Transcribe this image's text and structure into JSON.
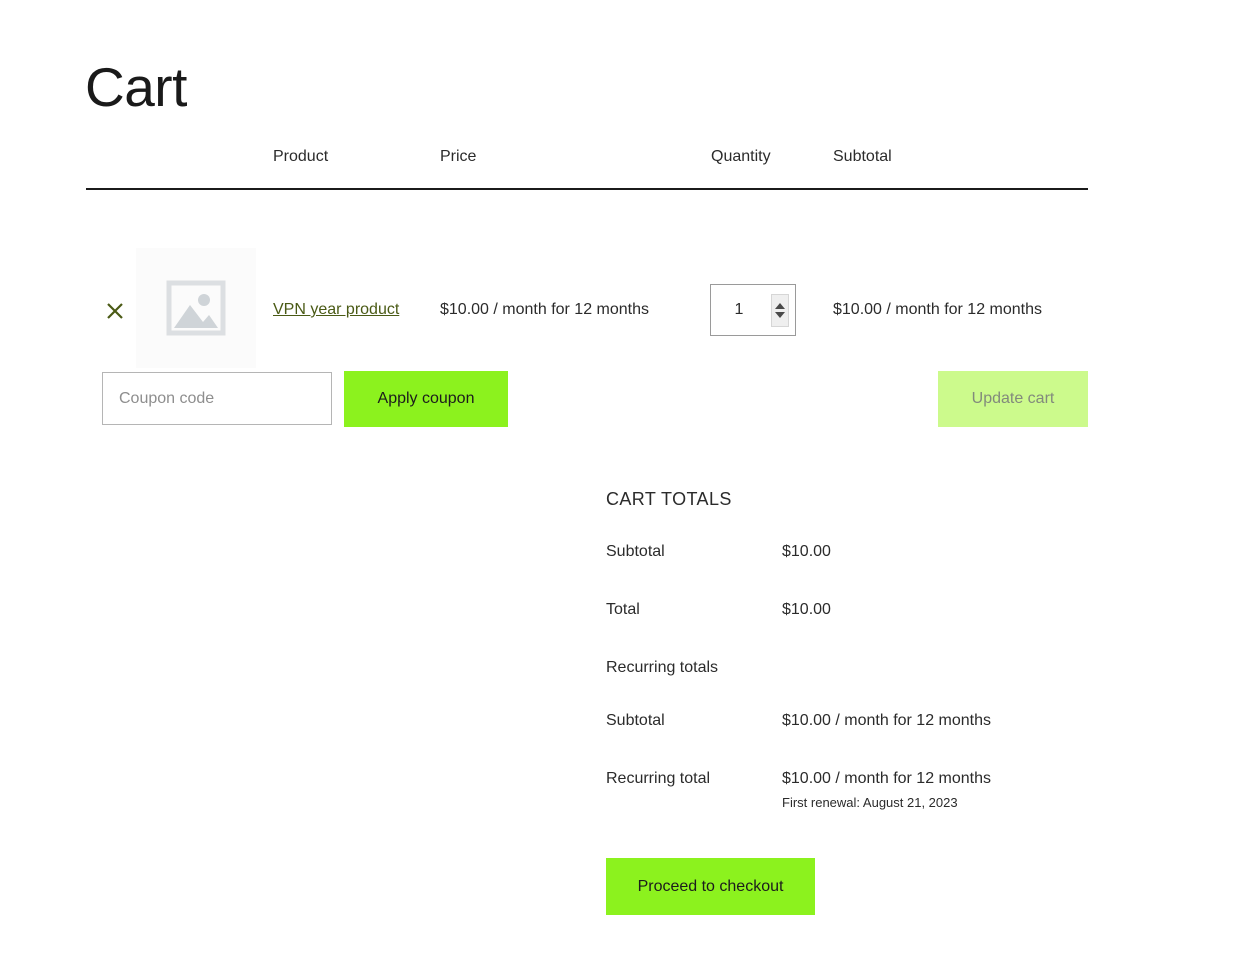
{
  "page": {
    "title": "Cart"
  },
  "cart_table": {
    "columns": [
      "Product",
      "Price",
      "Quantity",
      "Subtotal"
    ],
    "rows": [
      {
        "remove_icon": "close-x-icon",
        "thumbnail_icon": "image-placeholder-icon",
        "product_name": "VPN year product",
        "price": "$10.00 / month for 12 months",
        "quantity": "1",
        "subtotal": "$10.00 / month for 12 months"
      }
    ]
  },
  "coupon": {
    "placeholder": "Coupon code",
    "value": "",
    "apply_label": "Apply coupon"
  },
  "actions": {
    "update_cart_label": "Update cart"
  },
  "totals": {
    "title": "CART TOTALS",
    "rows": [
      {
        "label": "Subtotal",
        "value": "$10.00",
        "note": ""
      },
      {
        "label": "Total",
        "value": "$10.00",
        "note": ""
      },
      {
        "label": "Recurring totals",
        "value": "",
        "note": ""
      },
      {
        "label": "Subtotal",
        "value": "$10.00 / month for 12 months",
        "note": ""
      },
      {
        "label": "Recurring total",
        "value": "$10.00 / month for 12 months",
        "note": "First renewal: August 21, 2023"
      }
    ],
    "checkout_label": "Proceed to checkout"
  },
  "colors": {
    "accent_green": "#8cf21e",
    "disabled_green": "#ccfa8c",
    "link_green": "#4a5a15",
    "text": "#2b2b2b"
  }
}
